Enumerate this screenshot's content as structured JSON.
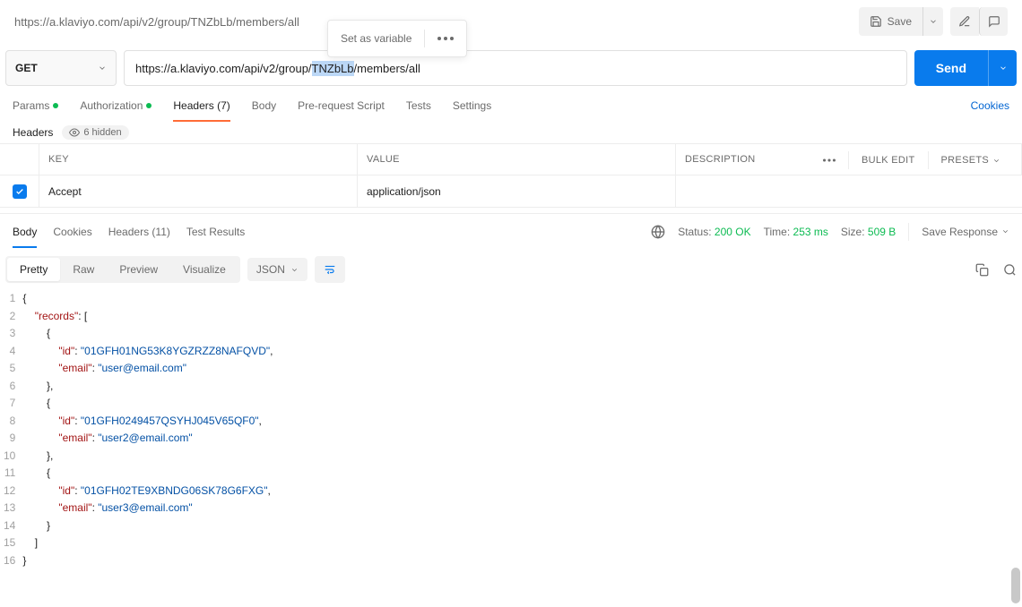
{
  "header": {
    "title": "https://a.klaviyo.com/api/v2/group/TNZbLb/members/all",
    "save_label": "Save",
    "set_variable_label": "Set as variable"
  },
  "request": {
    "method": "GET",
    "url_prefix": "https://a.klaviyo.com/api/v2/group/",
    "url_highlight": "TNZbLb",
    "url_suffix": "/members/all",
    "send_label": "Send"
  },
  "req_tabs": {
    "params": "Params",
    "authorization": "Authorization",
    "headers": "Headers",
    "headers_count": "(7)",
    "body": "Body",
    "pre_request": "Pre-request Script",
    "tests": "Tests",
    "settings": "Settings",
    "cookies": "Cookies"
  },
  "headers_section": {
    "label": "Headers",
    "hidden_label": "6 hidden"
  },
  "grid": {
    "col_key": "KEY",
    "col_value": "VALUE",
    "col_desc": "DESCRIPTION",
    "bulk_edit": "Bulk Edit",
    "presets": "Presets",
    "rows": [
      {
        "key": "Accept",
        "value": "application/json",
        "desc": ""
      }
    ]
  },
  "resp_tabs": {
    "body": "Body",
    "cookies": "Cookies",
    "headers": "Headers",
    "headers_count": "(11)",
    "test_results": "Test Results"
  },
  "status": {
    "label": "Status:",
    "code": "200 OK",
    "time_label": "Time:",
    "time_value": "253 ms",
    "size_label": "Size:",
    "size_value": "509 B",
    "save_response": "Save Response"
  },
  "view": {
    "pretty": "Pretty",
    "raw": "Raw",
    "preview": "Preview",
    "visualize": "Visualize",
    "format": "JSON"
  },
  "response_json": {
    "records": [
      {
        "id": "01GFH01NG53K8YGZRZZ8NAFQVD",
        "email": "user@email.com"
      },
      {
        "id": "01GFH0249457QSYHJ045V65QF0",
        "email": "user2@email.com"
      },
      {
        "id": "01GFH02TE9XBNDG06SK78G6FXG",
        "email": "user3@email.com"
      }
    ]
  },
  "code_lines": [
    "{",
    "    \"records\": [",
    "        {",
    "            \"id\": \"01GFH01NG53K8YGZRZZ8NAFQVD\",",
    "            \"email\": \"user@email.com\"",
    "        },",
    "        {",
    "            \"id\": \"01GFH0249457QSYHJ045V65QF0\",",
    "            \"email\": \"user2@email.com\"",
    "        },",
    "        {",
    "            \"id\": \"01GFH02TE9XBNDG06SK78G6FXG\",",
    "            \"email\": \"user3@email.com\"",
    "        }",
    "    ]",
    "}"
  ]
}
